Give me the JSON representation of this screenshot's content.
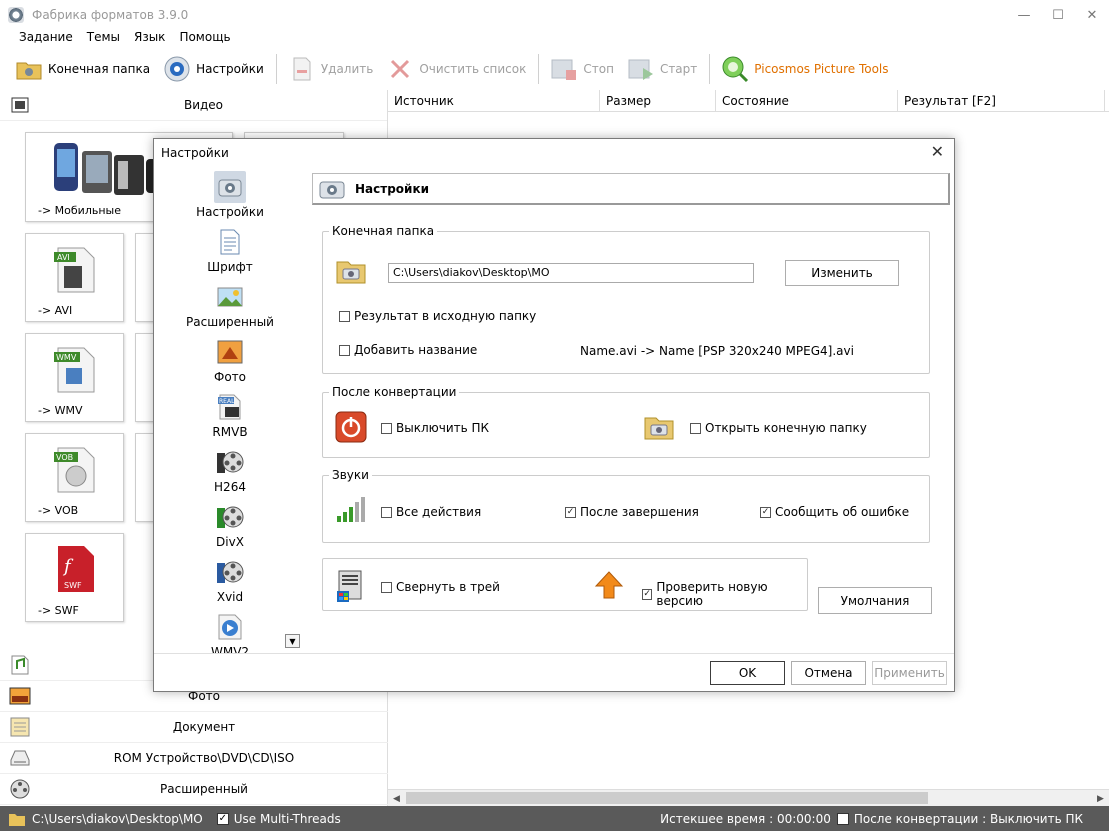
{
  "window": {
    "title": "Фабрика форматов 3.9.0",
    "min": "—",
    "max": "☐",
    "close": "✕"
  },
  "menu": [
    "Задание",
    "Темы",
    "Язык",
    "Помощь"
  ],
  "toolbar": {
    "dest_folder": "Конечная папка",
    "settings": "Настройки",
    "delete": "Удалить",
    "clear": "Очистить список",
    "stop": "Стоп",
    "start": "Старт",
    "picosmos": "Picosmos Picture Tools"
  },
  "left": {
    "video": "Видео",
    "photo": "Фото",
    "document": "Документ",
    "rom": "ROM Устройство\\DVD\\CD\\ISO",
    "advanced": "Расширенный",
    "tiles": [
      "-> Мобильные",
      "-> AVI",
      "-> WMV",
      "-> VOB",
      "-> SWF"
    ],
    "tile_badges": [
      "AVI",
      "WMV",
      "VOB",
      "SWF"
    ]
  },
  "columns": [
    "Источник",
    "Размер",
    "Состояние",
    "Результат [F2]"
  ],
  "status": {
    "path": "C:\\Users\\diakov\\Desktop\\MO",
    "multithreads": "Use Multi-Threads",
    "elapsed": "Истекшее время : 00:00:00",
    "after": "После конвертации : Выключить ПК",
    "check": "✓"
  },
  "dialog": {
    "title": "Настройки",
    "close": "✕",
    "header": "Настройки",
    "nav": [
      "Настройки",
      "Шрифт",
      "Расширенный",
      "Фото",
      "RMVB",
      "H264",
      "DivX",
      "Xvid",
      "WMV2"
    ],
    "nav_badge": "REAL",
    "dest": {
      "legend": "Конечная папка",
      "path": "C:\\Users\\diakov\\Desktop\\MO",
      "change": "Изменить",
      "to_source": "Результат в исходную папку",
      "add_name": "Добавить название",
      "name_example": "Name.avi  -> Name [PSP 320x240 MPEG4].avi"
    },
    "after": {
      "legend": "После конвертации",
      "shutdown": "Выключить ПК",
      "open_folder": "Открыть конечную папку"
    },
    "sounds": {
      "legend": "Звуки",
      "all": "Все действия",
      "finish": "После завершения",
      "error": "Сообщить об ошибке"
    },
    "tray": "Свернуть в трей",
    "update": "Проверить новую версию",
    "defaults": "Умолчания",
    "ok": "OK",
    "cancel": "Отмена",
    "apply": "Применить",
    "check": "✓"
  }
}
